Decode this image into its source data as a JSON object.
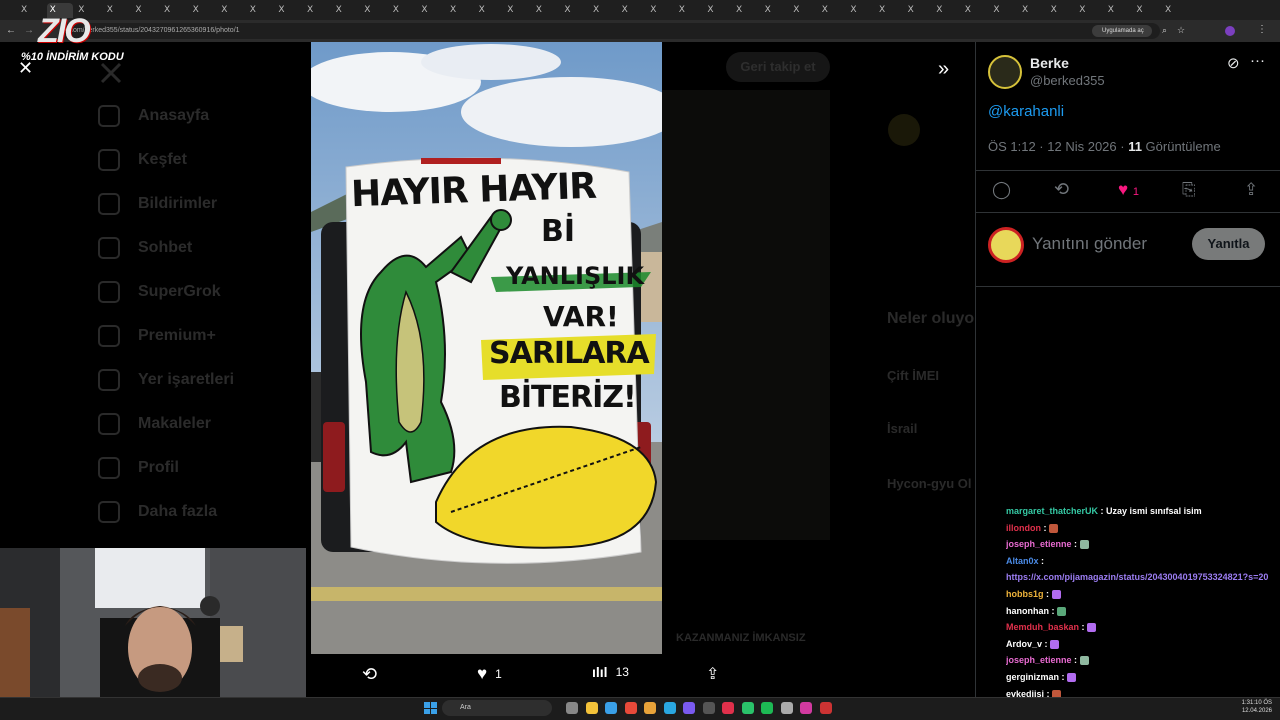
{
  "browser": {
    "url": "x.com/berked355/status/2043270961265360916/photo/1",
    "app_button": "Uygulamada aç",
    "tab_label": "X"
  },
  "overlay": {
    "logo": "ZIO",
    "promo": "%10 İNDİRİM KODU"
  },
  "photo_banner": {
    "line1": "HAYIR HAYIR",
    "line2": "Bİ",
    "line3": "YANLIŞLIK",
    "line4": "VAR!",
    "line5": "SARILARA",
    "line6": "BİTERİZ!"
  },
  "media_actions": {
    "likes": "1",
    "views": "13"
  },
  "background_nav": [
    "Anasayfa",
    "Keşfet",
    "Bildirimler",
    "Sohbet",
    "SuperGrok",
    "Premium+",
    "Yer işaretleri",
    "Makaleler",
    "Profil",
    "Daha fazla"
  ],
  "background_misc": {
    "follow_back": "Geri takip et",
    "trending_title": "Neler oluyor",
    "trend1": "Çift İMEI",
    "trend2": "İsrail",
    "trend3": "Hycon-gyu Ol",
    "media_caption": "KAZANMANIZ İMKANSIZ"
  },
  "tweet": {
    "name": "Berke",
    "handle": "@berked355",
    "mention": "@karahanli",
    "time": "ÖS 1:12 · 12 Nis 2026 · ",
    "views_count": "11",
    "views_label": " Görüntüleme",
    "like_count": "1",
    "reply_placeholder": "Yanıtını gönder",
    "reply_button": "Yanıtla"
  },
  "chat": [
    {
      "user": "margaret_thatcherUK",
      "color": "#35c9a4",
      "msg": "Uzay ismi sınıfsal isim",
      "emote": ""
    },
    {
      "user": "illondon",
      "color": "#e0304b",
      "msg": "",
      "emote": "#c0573b"
    },
    {
      "user": "joseph_etienne",
      "color": "#e86bd1",
      "msg": "",
      "emote": "#8fb8a0"
    },
    {
      "user": "Altan0x",
      "color": "#4b8be6",
      "msg": "",
      "emote": ""
    },
    {
      "user": "",
      "color": "#9c7df2",
      "msg": "https://x.com/pijamagazin/status/2043004019753324821?s=20",
      "emote": ""
    },
    {
      "user": "hobbs1g",
      "color": "#f0b43b",
      "msg": "",
      "emote": "#b26cf0"
    },
    {
      "user": "hanonhan",
      "color": "#ffffff",
      "msg": "",
      "emote": "#5aa87a"
    },
    {
      "user": "Memduh_baskan",
      "color": "#e0304b",
      "msg": "",
      "emote": "#b26cf0"
    },
    {
      "user": "Ardov_v",
      "color": "#ffffff",
      "msg": "",
      "emote": "#b26cf0"
    },
    {
      "user": "joseph_etienne",
      "color": "#e86bd1",
      "msg": "",
      "emote": "#8fb8a0"
    },
    {
      "user": "gerginizman",
      "color": "#ffffff",
      "msg": "",
      "emote": "#b26cf0"
    },
    {
      "user": "evkediisi",
      "color": "#ffffff",
      "msg": "",
      "emote": "#c0573b"
    }
  ],
  "taskbar": {
    "search": "Ara",
    "time": "1:31:10 ÖS",
    "date": "12.04.2026"
  },
  "colors": {
    "link": "#1d9bf0",
    "like": "#f91880",
    "muted": "#71767b"
  }
}
